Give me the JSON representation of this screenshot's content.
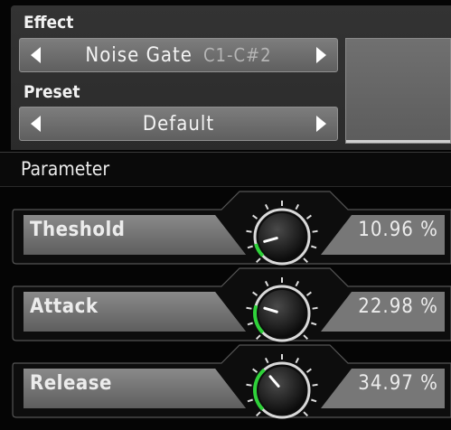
{
  "effect": {
    "label": "Effect",
    "name": "Noise Gate",
    "range": "C1-C#2"
  },
  "preset": {
    "label": "Preset",
    "name": "Default"
  },
  "parameters": {
    "header": "Parameter",
    "items": [
      {
        "name": "Theshold",
        "value": "10.96 %",
        "level": 0.1096
      },
      {
        "name": "Attack",
        "value": "22.98 %",
        "level": 0.2298
      },
      {
        "name": "Release",
        "value": "34.97 %",
        "level": 0.3497
      }
    ]
  },
  "colors": {
    "accent": "#2fd23a",
    "panel": "#2e2e2e",
    "field": "#6e6e6e"
  },
  "icons": {
    "prev": "triangle-left-icon",
    "next": "triangle-right-icon",
    "knob": "rotary-knob-icon"
  }
}
